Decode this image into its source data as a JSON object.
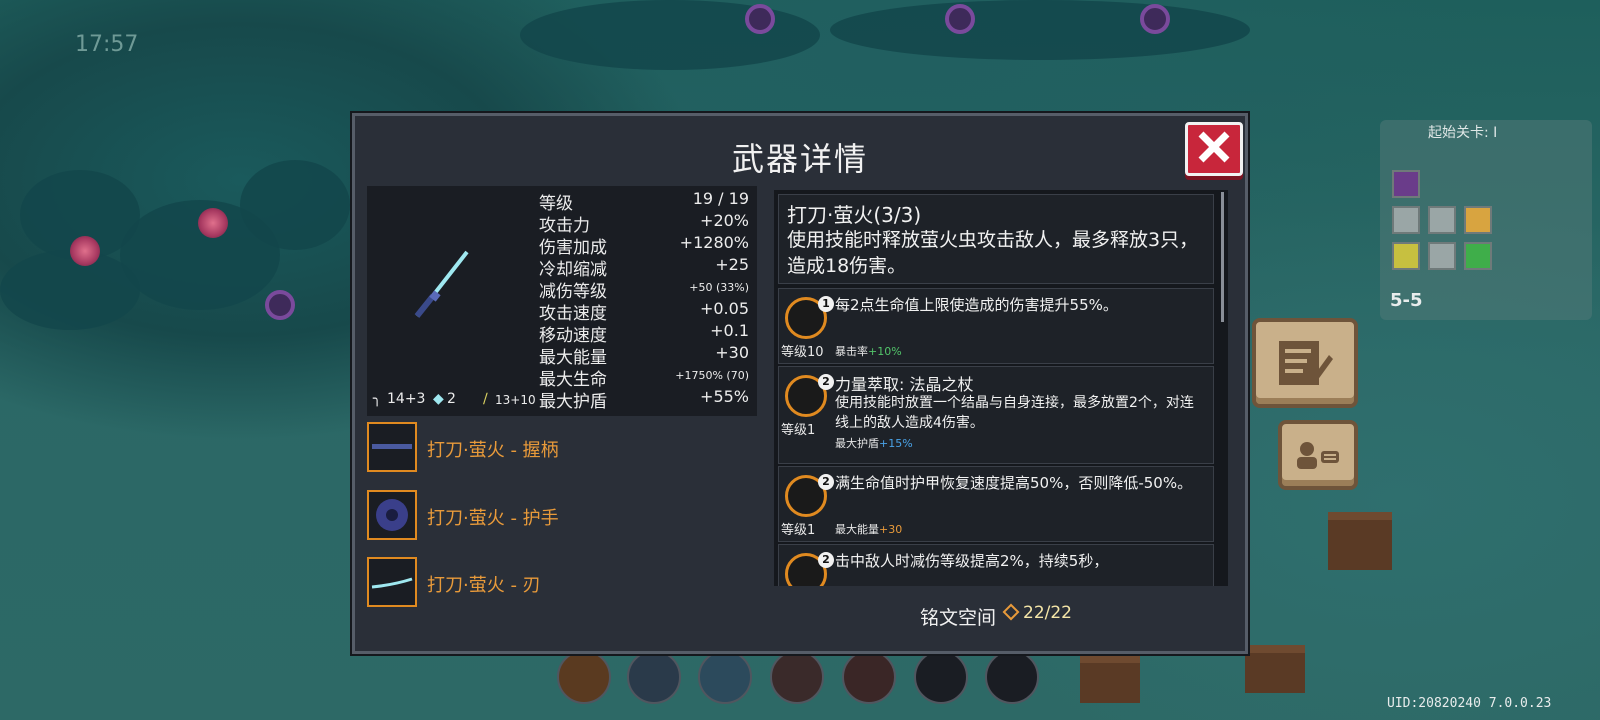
{
  "hud": {
    "time": "17:57"
  },
  "minimap": {
    "title": "起始关卡: I",
    "level": "5-5"
  },
  "panel": {
    "title": "武器详情",
    "stats": [
      {
        "label": "等级",
        "value": "19 / 19"
      },
      {
        "label": "攻击力",
        "value": "+20%"
      },
      {
        "label": "伤害加成",
        "value": "+1280%"
      },
      {
        "label": "冷却缩减",
        "value": "+25"
      },
      {
        "label": "减伤等级",
        "value": "+50 (33%)"
      },
      {
        "label": "攻击速度",
        "value": "+0.05"
      },
      {
        "label": "移动速度",
        "value": "+0.1"
      },
      {
        "label": "最大能量",
        "value": "+30"
      },
      {
        "label": "最大生命",
        "value": "+1750% (70)"
      },
      {
        "label": "最大护盾",
        "value": "+55%"
      }
    ],
    "mini_stats": {
      "a": "14+3",
      "b": "2",
      "c": "13+10"
    },
    "parts": [
      {
        "label": "打刀·萤火 - 握柄"
      },
      {
        "label": "打刀·萤火 - 护手"
      },
      {
        "label": "打刀·萤火 - 刃"
      }
    ],
    "inscription_head": {
      "title": "打刀·萤火(3/3)",
      "desc": "使用技能时释放萤火虫攻击敌人，最多释放3只，造成18伤害。"
    },
    "inscriptions": [
      {
        "num": "1",
        "level": "等级10",
        "title": "",
        "desc": "每2点生命值上限使造成的伤害提升55%。",
        "bonus_label": "暴击率",
        "bonus_value": "+10%",
        "bonus_color": "green"
      },
      {
        "num": "2",
        "level": "等级1",
        "title": "力量萃取: 法晶之杖",
        "desc": "使用技能时放置一个结晶与自身连接，最多放置2个，对连线上的敌人造成4伤害。",
        "bonus_label": "最大护盾",
        "bonus_value": "+15%",
        "bonus_color": "blue"
      },
      {
        "num": "2",
        "level": "等级1",
        "title": "",
        "desc": "满生命值时护甲恢复速度提高50%，否则降低-50%。",
        "bonus_label": "最大能量",
        "bonus_value": "+30",
        "bonus_color": "orange"
      },
      {
        "num": "2",
        "level": "",
        "title": "",
        "desc": "击中敌人时减伤等级提高2%，持续5秒，",
        "bonus_label": "",
        "bonus_value": "",
        "bonus_color": ""
      }
    ],
    "inscription_space_label": "铭文空间",
    "inscription_space_value": "22/22"
  },
  "footer": {
    "uid": "UID:20820240 7.0.0.23"
  }
}
